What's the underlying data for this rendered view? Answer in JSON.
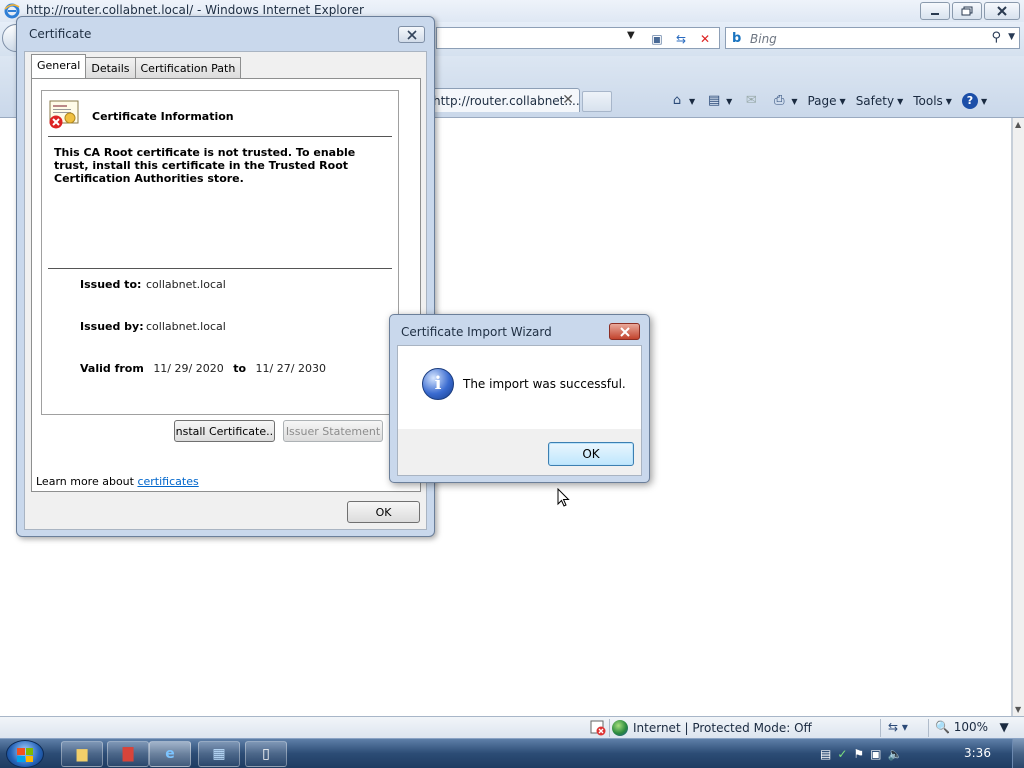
{
  "ie": {
    "window_title": "http://router.collabnet.local/ - Windows Internet Explorer",
    "search_placeholder": "Bing",
    "tab_title": "http://router.collabnet....",
    "commands": {
      "page": "Page",
      "safety": "Safety",
      "tools": "Tools"
    },
    "status": {
      "zone": "Internet | Protected Mode: Off",
      "zoom": "100%"
    }
  },
  "cert_dialog": {
    "title": "Certificate",
    "tabs": [
      "General",
      "Details",
      "Certification Path"
    ],
    "info_title": "Certificate Information",
    "warning": "This CA Root certificate is not trusted. To enable trust, install this certificate in the Trusted Root Certification Authorities store.",
    "issued_to_label": "Issued to:",
    "issued_to": "collabnet.local",
    "issued_by_label": "Issued by:",
    "issued_by": "collabnet.local",
    "valid_from_label": "Valid from",
    "valid_from": "11/ 29/ 2020",
    "valid_to_label": "to",
    "valid_to": "11/ 27/ 2030",
    "install_button": "Install Certificate...",
    "issuer_button": "Issuer Statement",
    "learn_more_prefix": "Learn more about ",
    "learn_more_link": "certificates",
    "ok_button": "OK"
  },
  "wizard": {
    "title": "Certificate Import Wizard",
    "message": "The import was successful.",
    "ok_button": "OK"
  },
  "taskbar": {
    "clock": "3:36"
  }
}
